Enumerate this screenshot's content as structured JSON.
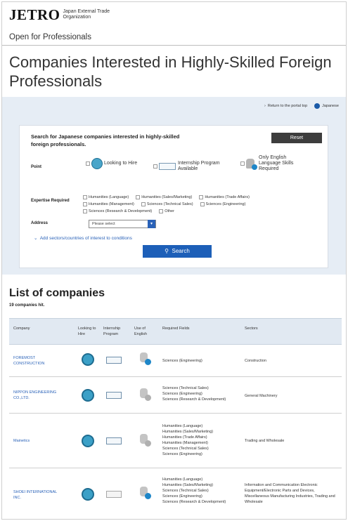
{
  "header": {
    "logo_word": "JETRO",
    "logo_sub_line1": "Japan External Trade",
    "logo_sub_line2": "Organization",
    "section": "Open for Professionals"
  },
  "page": {
    "title": "Companies Interested in Highly-Skilled Foreign Professionals",
    "return_link": "Return to the portal top",
    "language_link": "Japanese"
  },
  "search": {
    "description": "Search for Japanese companies interested in highly-skilled foreign professionals.",
    "reset_label": "Reset",
    "point_label": "Point",
    "point_options": {
      "looking": "Looking to Hire",
      "internship": "Internship Program Available",
      "english": "Only English Language Skills Required"
    },
    "expertise_label": "Expertise Required",
    "expertise_options": [
      "Humanities (Language)",
      "Humanities (Sales/Marketing)",
      "Humanities (Trade Affairs)",
      "Humanities (Management)",
      "Sciences (Technical Sales)",
      "Sciences (Engineering)",
      "Sciences (Research & Development)",
      "Other"
    ],
    "address_label": "Address",
    "address_value": "Please select",
    "add_sectors_link": "Add sectors/countries of interest to conditions",
    "search_button": "Search"
  },
  "list": {
    "title": "List of companies",
    "count": "19 companies hit.",
    "columns": {
      "company": "Company",
      "looking": "Looking to Hire",
      "internship": "Internship Program",
      "english": "Use of English",
      "fields": "Required Fields",
      "sectors": "Sectors"
    },
    "rows": [
      {
        "company": "FOREMOST CONSTRUCTION",
        "internship_on": true,
        "english_on": true,
        "fields": [
          "Sciences (Engineering)"
        ],
        "sectors": "Construction"
      },
      {
        "company": "NIPPON ENGINEERING CO.,LTD.",
        "internship_on": true,
        "english_on": false,
        "fields": [
          "Sciences (Technical Sales)",
          "Sciences (Engineering)",
          "Sciences (Research & Development)"
        ],
        "sectors": "General Machinery"
      },
      {
        "company": "Mainetics",
        "internship_on": true,
        "english_on": false,
        "fields": [
          "Humanities (Language)",
          "Humanities (Sales/Marketing)",
          "Humanities (Trade Affairs)",
          "Humanities (Management)",
          "Sciences (Technical Sales)",
          "Sciences (Engineering)"
        ],
        "sectors": "Trading and Wholesale"
      },
      {
        "company": "SHOEI INTERNATIONAL INC.",
        "internship_on": false,
        "english_on": true,
        "fields": [
          "Humanities (Language)",
          "Humanities (Sales/Marketing)",
          "Sciences (Technical Sales)",
          "Sciences (Engineering)",
          "Sciences (Research & Development)"
        ],
        "sectors": "Information and Communication Electronic Equipment/Electronic Parts and Devices, Miscellaneous Manufacturing Industries, Trading and Wholesale"
      }
    ]
  },
  "colors": {
    "accent_blue": "#1d5fb8",
    "panel_blue": "#e6edf5",
    "table_header": "#e1e9f2",
    "reset_button": "#3d3d3d"
  }
}
